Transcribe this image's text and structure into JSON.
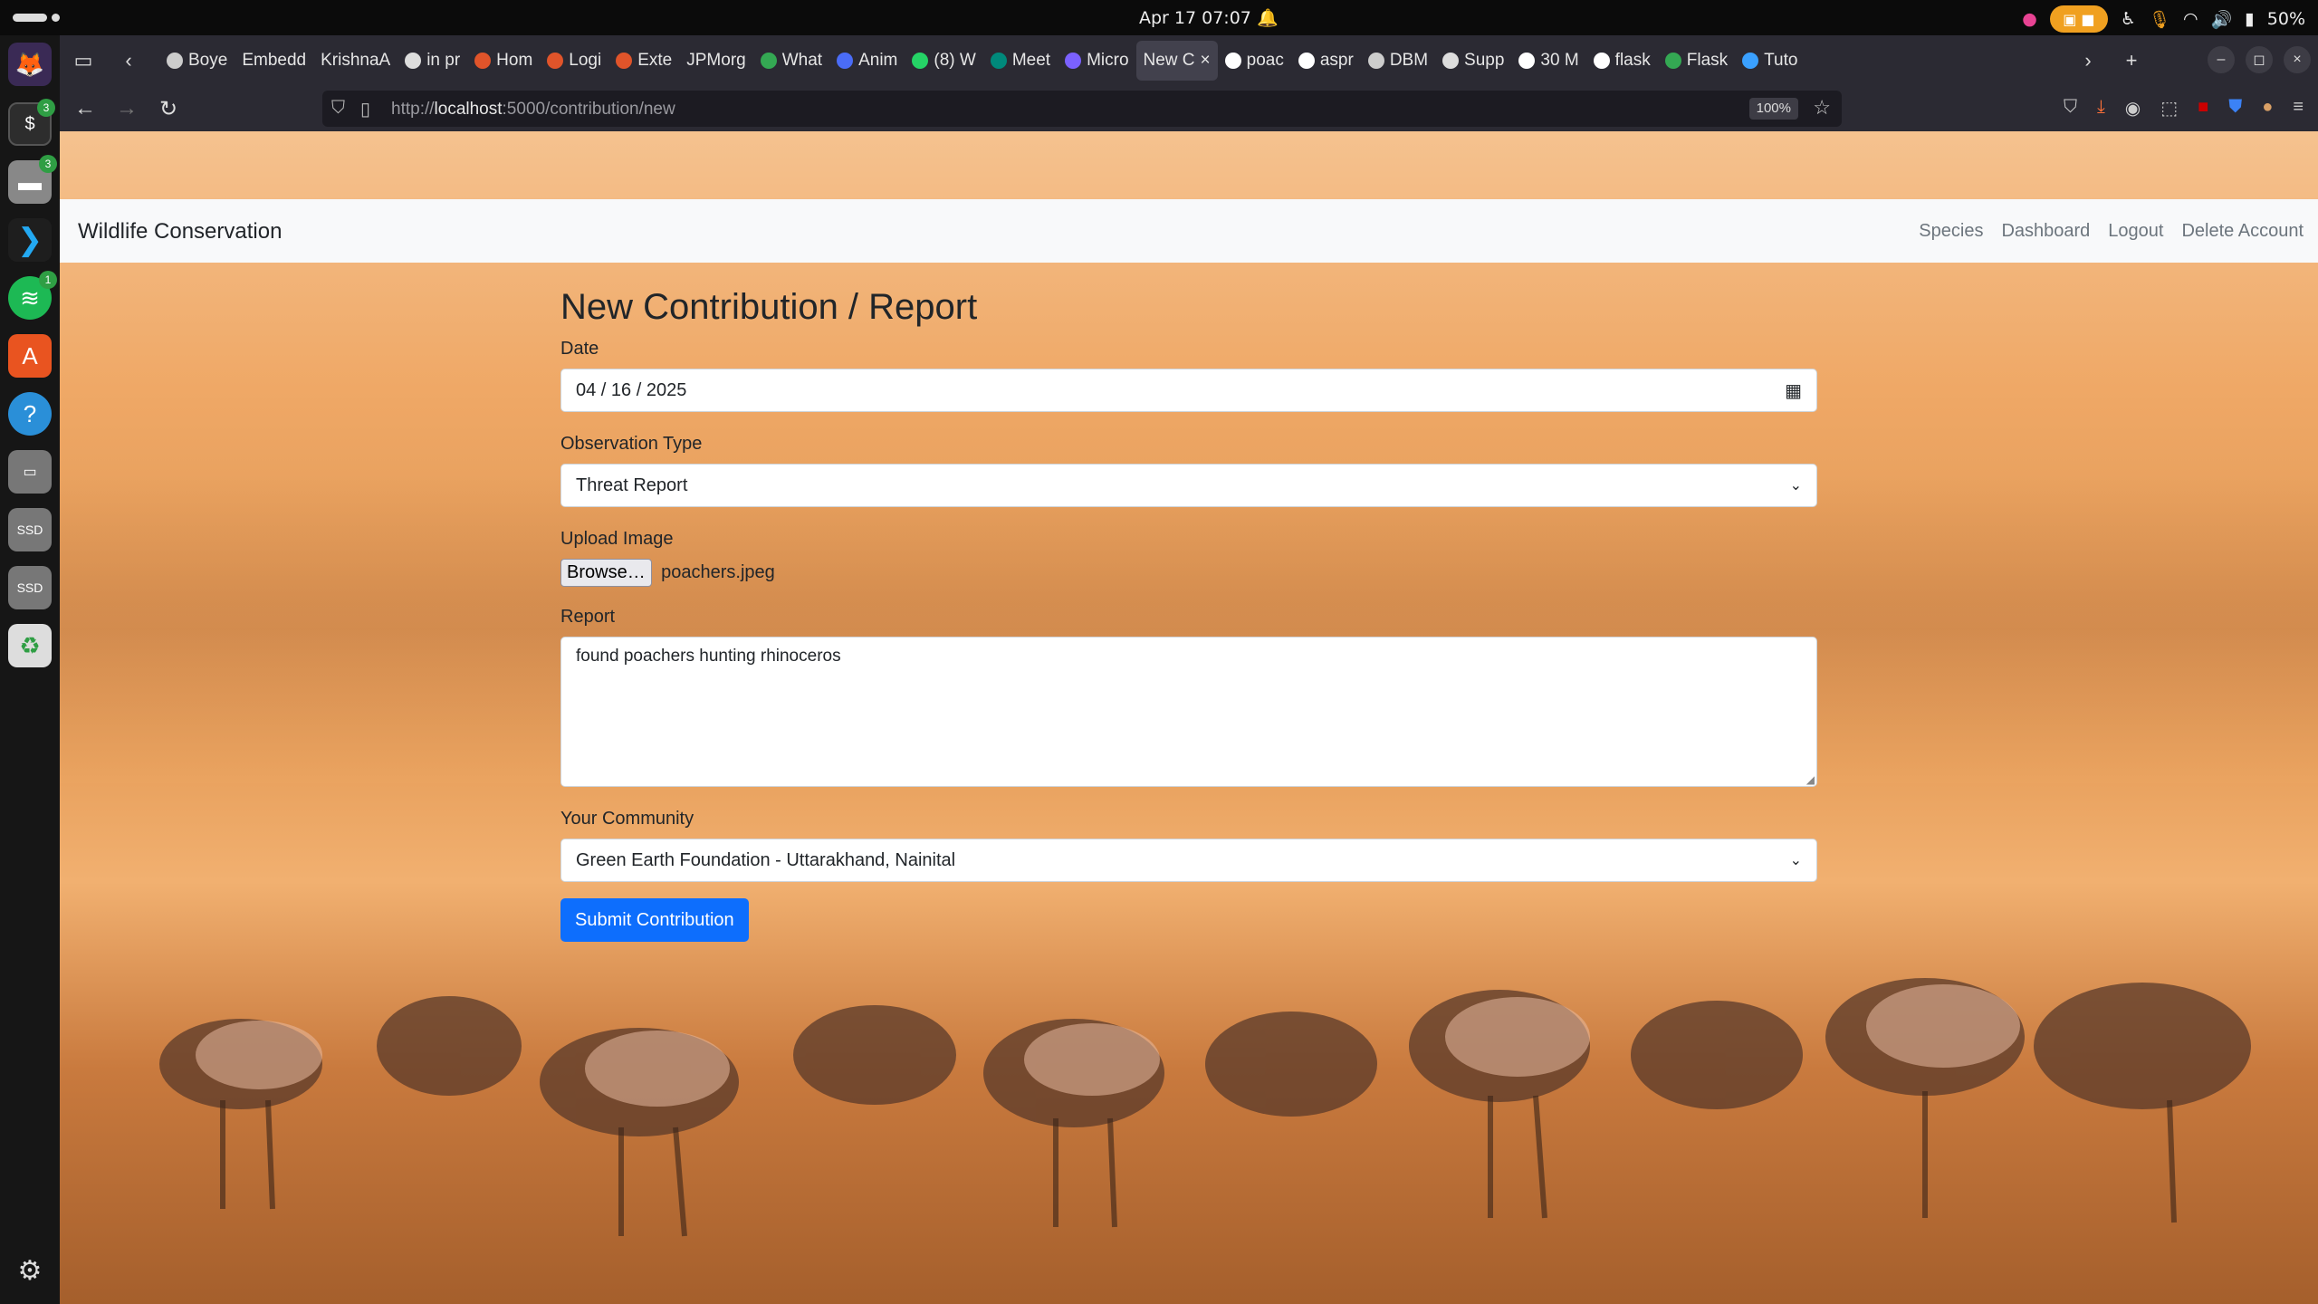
{
  "system": {
    "clock": "Apr 17  07:07",
    "battery": "50%"
  },
  "dock": {
    "badges": [
      "3",
      "3",
      "1"
    ]
  },
  "browser": {
    "tabs": [
      {
        "label": "Boye",
        "color": "#cccccc"
      },
      {
        "label": "Embedd",
        "color": ""
      },
      {
        "label": "KrishnaA",
        "color": ""
      },
      {
        "label": "in pr",
        "color": "#dddddd"
      },
      {
        "label": "Hom",
        "color": "#e0542a"
      },
      {
        "label": "Logi",
        "color": "#e0542a"
      },
      {
        "label": "Exte",
        "color": "#e0542a"
      },
      {
        "label": "JPMorg",
        "color": ""
      },
      {
        "label": "What",
        "color": "#34a853"
      },
      {
        "label": "Anim",
        "color": "#4a6cf7"
      },
      {
        "label": "(8) W",
        "color": "#25d366"
      },
      {
        "label": "Meet",
        "color": "#00897b"
      },
      {
        "label": "Micro",
        "color": "#7b61ff"
      },
      {
        "label": "New C",
        "color": ""
      },
      {
        "label": "poac",
        "color": "#ffffff"
      },
      {
        "label": "aspr",
        "color": "#ffffff"
      },
      {
        "label": "DBM",
        "color": "#cccccc"
      },
      {
        "label": "Supp",
        "color": "#dddddd"
      },
      {
        "label": "30 M",
        "color": "#ffffff"
      },
      {
        "label": "flask",
        "color": "#ffffff"
      },
      {
        "label": "Flask",
        "color": "#34a853"
      },
      {
        "label": "Tuto",
        "color": "#3aa0ff"
      }
    ],
    "active_tab_index": 13,
    "url_prefix": "http://",
    "url_host": "localhost",
    "url_path": ":5000/contribution/new",
    "zoom": "100%"
  },
  "site": {
    "brand": "Wildlife Conservation",
    "menu": [
      "Species",
      "Dashboard",
      "Logout",
      "Delete Account"
    ]
  },
  "form": {
    "title": "New Contribution / Report",
    "date_label": "Date",
    "date_value": "04 / 16 / 2025",
    "type_label": "Observation Type",
    "type_value": "Threat Report",
    "upload_label": "Upload Image",
    "browse_label": "Browse…",
    "file_name": "poachers.jpeg",
    "report_label": "Report",
    "report_value": "found poachers hunting rhinoceros",
    "community_label": "Your Community",
    "community_value": "Green Earth Foundation - Uttarakhand, Nainital",
    "submit_label": "Submit Contribution"
  },
  "colors": {
    "primary": "#0d6efd",
    "navbar_bg": "#f8f9fa",
    "browser_chrome": "#2b2a33"
  }
}
